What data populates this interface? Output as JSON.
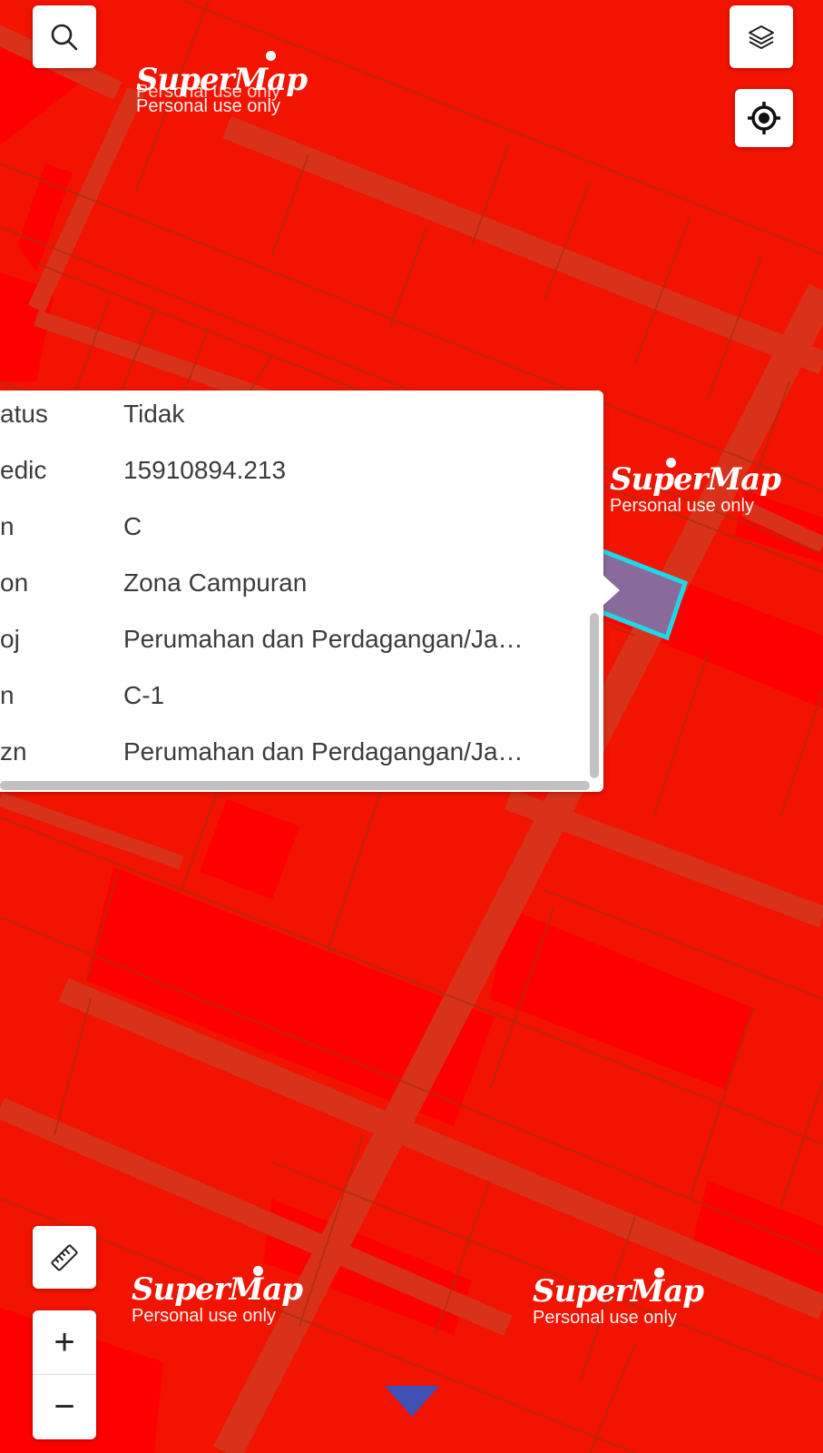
{
  "popup": {
    "rows": [
      {
        "key": "atus",
        "value": "Tidak"
      },
      {
        "key": "edic",
        "value": "15910894.213"
      },
      {
        "key": "n",
        "value": "C"
      },
      {
        "key": "on",
        "value": "Zona Campuran"
      },
      {
        "key": "oj",
        "value": "Perumahan dan Perdagangan/Ja…"
      },
      {
        "key": "n",
        "value": "C-1"
      },
      {
        "key": "zn",
        "value": "Perumahan dan Perdagangan/Ja…"
      }
    ]
  },
  "watermark": {
    "brand": "SuperMap",
    "subtitle": "Personal use only"
  },
  "controls": {
    "zoom_in_label": "+",
    "zoom_out_label": "−"
  },
  "icons": {
    "search": "search-icon",
    "layers": "layers-icon",
    "locate": "locate-icon",
    "measure": "ruler-icon",
    "expand": "triangle-down-icon"
  },
  "colors": {
    "parcel_fill": "#f21300",
    "parcel_light": "#ff0000",
    "road": "#d8321a",
    "boundary": "#a8300e",
    "selected_fill": "#8a6a9b",
    "selected_outline": "#1ed8e6",
    "expand_arrow": "#3f51b5"
  }
}
